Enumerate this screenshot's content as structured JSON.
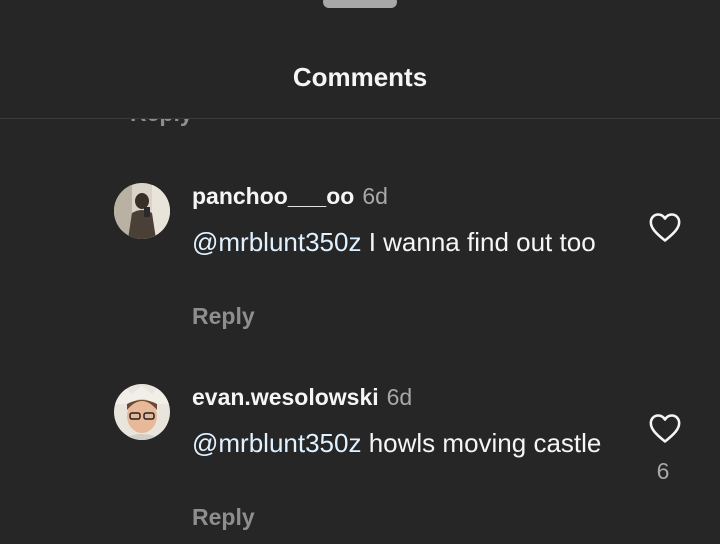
{
  "header": {
    "title": "Comments"
  },
  "previous_reply": "Reply",
  "comments": [
    {
      "username": "panchoo___oo",
      "time": "6d",
      "mention": "@mrblunt350z",
      "text": " I wanna find out too",
      "reply_label": "Reply",
      "likes": "",
      "avatar_icon": "user-photo-avatar",
      "like_icon": "heart-outline-icon"
    },
    {
      "username": "evan.wesolowski",
      "time": "6d",
      "mention": "@mrblunt350z",
      "text": " howls moving castle",
      "reply_label": "Reply",
      "likes": "6",
      "avatar_icon": "user-photo-avatar",
      "like_icon": "heart-outline-icon"
    }
  ],
  "colors": {
    "background": "#262626",
    "text": "#f5f5f5",
    "secondary": "#8e8e8e",
    "mention": "#e0f1ff"
  }
}
